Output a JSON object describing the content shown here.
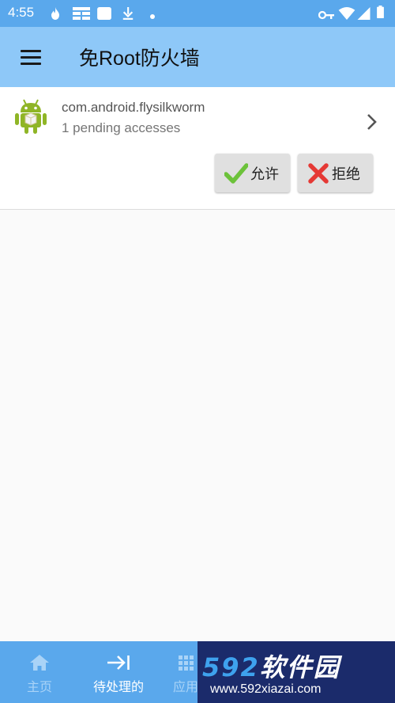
{
  "status_bar": {
    "time": "4:55",
    "left_icons": [
      "flame-icon",
      "grid-icon",
      "square-icon",
      "download-icon",
      "dot-icon"
    ],
    "right_icons": [
      "key-icon",
      "wifi-icon",
      "signal-icon",
      "battery-icon"
    ]
  },
  "app_bar": {
    "title": "免Root防火墙",
    "menu_icon": "menu-icon"
  },
  "request": {
    "package_name": "com.android.flysilkworm",
    "pending_text": "1 pending accesses",
    "allow_label": "允许",
    "deny_label": "拒绝"
  },
  "bottom_nav": {
    "items": [
      {
        "label": "主页",
        "icon": "home-icon"
      },
      {
        "label": "待处理的",
        "icon": "arrow-to-bar-icon"
      },
      {
        "label": "应用",
        "icon": "apps-grid-icon"
      }
    ]
  },
  "watermark": {
    "number": "592",
    "brand": "软件园",
    "url": "www.592xiazai.com"
  },
  "colors": {
    "status_bar": "#5aa8ec",
    "app_bar": "#8ec8f8",
    "bottom_nav": "#5aa8ec",
    "allow_check": "#6cc23a",
    "deny_x": "#e53935",
    "android_green": "#8fb526"
  }
}
